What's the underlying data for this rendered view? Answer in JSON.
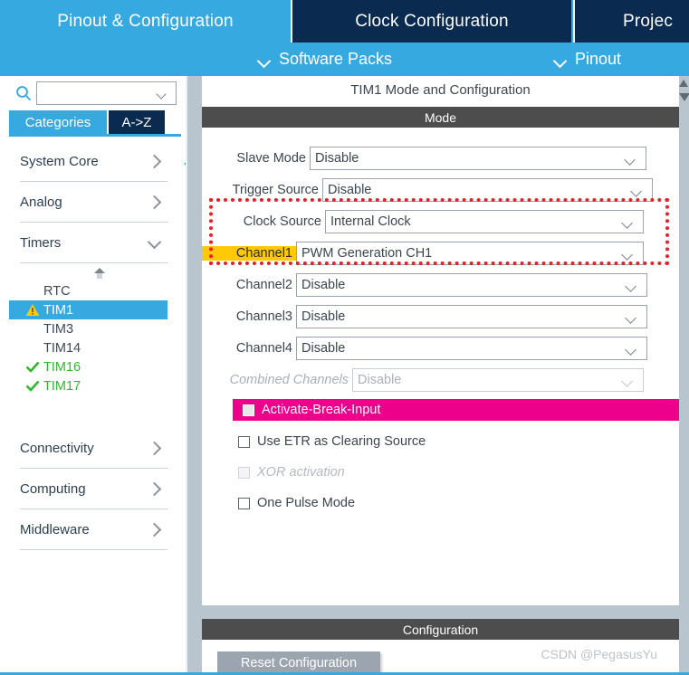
{
  "tabs": [
    {
      "label": "Pinout & Configuration",
      "state": "active"
    },
    {
      "label": "Clock Configuration",
      "state": "inactive"
    },
    {
      "label": "Projec",
      "state": "inactive"
    }
  ],
  "submenu": [
    {
      "label": "Software Packs",
      "icon": "chevron-down-icon"
    },
    {
      "label": "Pinout",
      "icon": "chevron-down-icon"
    }
  ],
  "sidebar": {
    "search": {
      "value": "",
      "placeholder": "",
      "icon": "search-icon"
    },
    "gear_icon": "gear-icon",
    "view_tabs": [
      {
        "label": "Categories",
        "state": "active"
      },
      {
        "label": "A->Z",
        "state": "inactive"
      }
    ],
    "categories": [
      {
        "label": "System Core",
        "arrow": "chevron-right-icon",
        "expanded": false
      },
      {
        "label": "Analog",
        "arrow": "chevron-right-icon",
        "expanded": false
      },
      {
        "label": "Timers",
        "arrow": "chevron-down-icon",
        "expanded": true
      },
      {
        "label": "Connectivity",
        "arrow": "chevron-right-icon",
        "expanded": false
      },
      {
        "label": "Computing",
        "arrow": "chevron-right-icon",
        "expanded": false
      },
      {
        "label": "Middleware",
        "arrow": "chevron-right-icon",
        "expanded": false
      }
    ],
    "timers": [
      {
        "label": "RTC",
        "status": "none",
        "selected": false
      },
      {
        "label": "TIM1",
        "status": "warning",
        "selected": true
      },
      {
        "label": "TIM3",
        "status": "none",
        "selected": false
      },
      {
        "label": "TIM14",
        "status": "none",
        "selected": false
      },
      {
        "label": "TIM16",
        "status": "ok",
        "selected": false
      },
      {
        "label": "TIM17",
        "status": "ok",
        "selected": false
      }
    ]
  },
  "main": {
    "panel_title": "TIM1 Mode and Configuration",
    "mode_header": "Mode",
    "configuration_header": "Configuration",
    "fields": [
      {
        "label": "Slave Mode",
        "value": "Disable",
        "disabled": false,
        "highlight": false
      },
      {
        "label": "Trigger Source",
        "value": "Disable",
        "disabled": false,
        "highlight": false
      },
      {
        "label": "Clock Source",
        "value": "Internal Clock",
        "disabled": false,
        "highlight": false
      },
      {
        "label": "Channel1",
        "value": "PWM Generation CH1",
        "disabled": false,
        "highlight": true
      },
      {
        "label": "Channel2",
        "value": "Disable",
        "disabled": false,
        "highlight": false
      },
      {
        "label": "Channel3",
        "value": "Disable",
        "disabled": false,
        "highlight": false
      },
      {
        "label": "Channel4",
        "value": "Disable",
        "disabled": false,
        "highlight": false
      },
      {
        "label": "Combined Channels",
        "value": "Disable",
        "disabled": true,
        "highlight": false
      }
    ],
    "checkboxes": [
      {
        "label": "Activate-Break-Input",
        "checked": false,
        "disabled": false,
        "style": "magenta"
      },
      {
        "label": "Use ETR as Clearing Source",
        "checked": false,
        "disabled": false,
        "style": "normal"
      },
      {
        "label": "XOR activation",
        "checked": false,
        "disabled": true,
        "style": "normal"
      },
      {
        "label": "One Pulse Mode",
        "checked": false,
        "disabled": false,
        "style": "normal"
      }
    ],
    "reset_button": "Reset Configuration",
    "watermark": "CSDN @PegasusYu"
  },
  "annotation": {
    "type": "red-dotted-rectangle",
    "color": "#ee1c25",
    "covers": [
      "Clock Source",
      "Channel1"
    ]
  },
  "colors": {
    "accent_blue": "#36A9E1",
    "dark_navy": "#0B2A50",
    "section_gray": "#4d4d4d",
    "magenta": "#EC008C",
    "highlight_yellow": "#FFC907",
    "ok_green": "#2eb82e",
    "warn_yellow": "#FFC907",
    "splitter": "#b8c4ce",
    "annotation_red": "#ee1c25"
  }
}
